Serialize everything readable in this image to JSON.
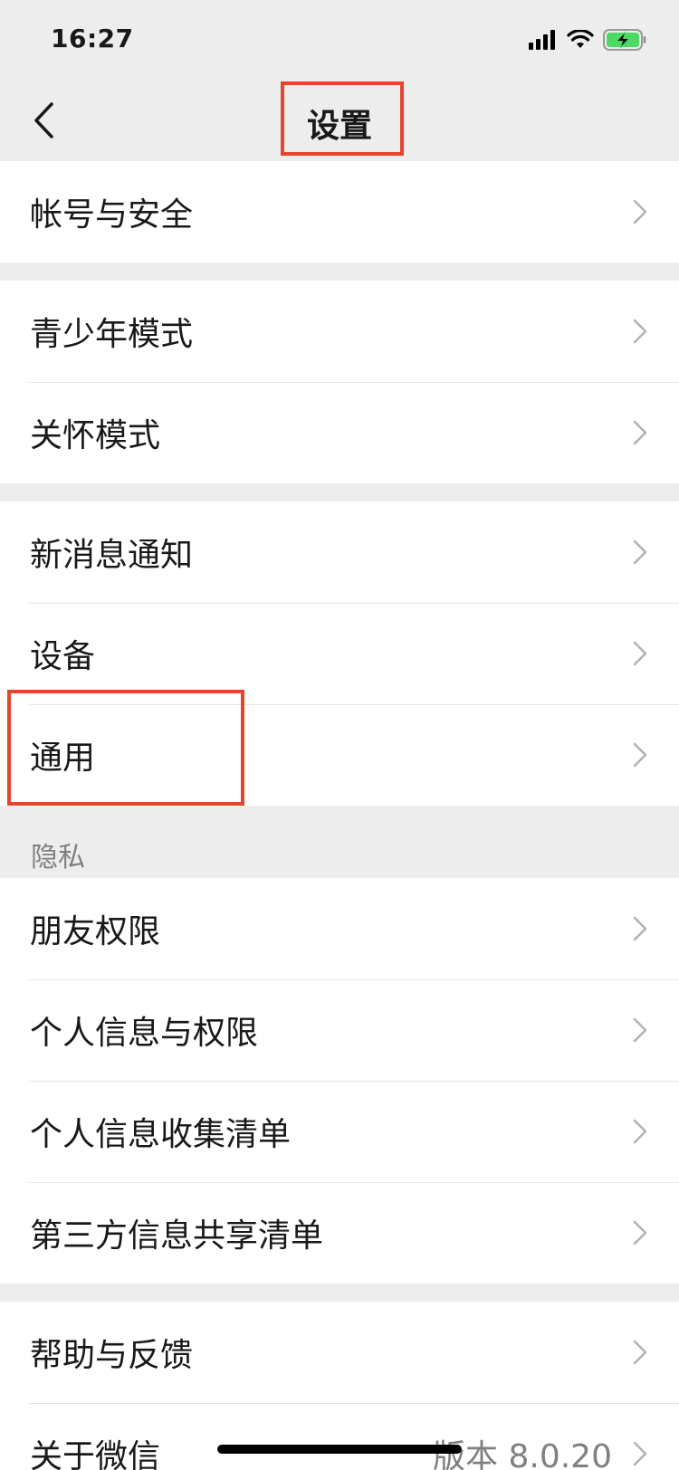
{
  "status": {
    "time": "16:27"
  },
  "nav": {
    "title": "设置"
  },
  "groups": [
    {
      "items": [
        {
          "label": "帐号与安全"
        }
      ]
    },
    {
      "items": [
        {
          "label": "青少年模式"
        },
        {
          "label": "关怀模式"
        }
      ]
    },
    {
      "items": [
        {
          "label": "新消息通知"
        },
        {
          "label": "设备"
        },
        {
          "label": "通用"
        }
      ]
    },
    {
      "header": "隐私",
      "items": [
        {
          "label": "朋友权限"
        },
        {
          "label": "个人信息与权限"
        },
        {
          "label": "个人信息收集清单"
        },
        {
          "label": "第三方信息共享清单"
        }
      ]
    },
    {
      "items": [
        {
          "label": "帮助与反馈"
        },
        {
          "label": "关于微信",
          "value": "版本 8.0.20"
        }
      ]
    }
  ],
  "icons": [
    "signal-icon",
    "wifi-icon",
    "battery-charging-icon",
    "back-chevron-icon",
    "chevron-right-icon"
  ],
  "colors": {
    "highlight": "#e5452e",
    "battery": "#4cd964",
    "background": "#ededed"
  }
}
